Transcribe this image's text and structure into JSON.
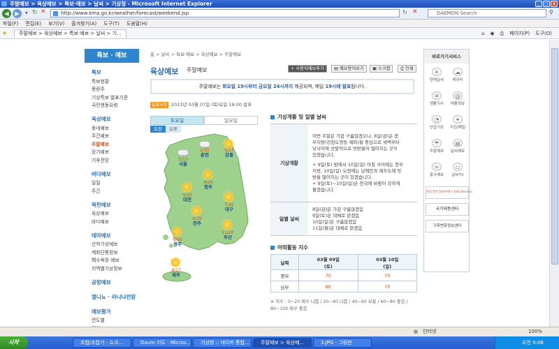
{
  "window": {
    "title": "주말예보 > 육상예보 > 특보·예보 > 날씨 > 기상청 - Microsoft Internet Explorer",
    "min": "_",
    "max": "□",
    "close": "x"
  },
  "browser": {
    "url": "http://www.kma.go.kr/weather/forecast/weekend.jsp",
    "search_placeholder": "DAEMON Search",
    "menu": [
      "파일(F)",
      "편집(E)",
      "보기(V)",
      "즐겨찾기(A)",
      "도구(T)",
      "도움말(H)"
    ],
    "tab": "주말예보 > 육상예보 > 특보·예보 > 날씨 > 기...",
    "tools": [
      "페이지(P)",
      "도구(O)"
    ],
    "status": "인터넷",
    "zoom": "100%"
  },
  "taskbar": {
    "start": "시작",
    "items": [
      "조합/조합기 - 쇼크...",
      "Daum 지도 - Micros...",
      "기상청 :: 네이버 통합...",
      "주말예보 > 육상예...",
      "3.JPG - 그림판"
    ],
    "time": "오전 9:06"
  },
  "sidebar": {
    "header": "특보 · 예보",
    "sections": [
      {
        "title": "특보",
        "items": [
          "특보현황",
          "풍랑주",
          "기상특보 발표기준",
          "국민행동요령"
        ]
      },
      {
        "title": "육상예보",
        "items": [
          "동네예보",
          "주간예보",
          "주말예보",
          "장기예보",
          "기후전망"
        ]
      },
      {
        "title": "바다예보",
        "items": [
          "일일",
          "주간"
        ]
      },
      {
        "title": "북한예보",
        "items": [
          "육상예보",
          "바다예보"
        ]
      },
      {
        "title": "테마예보",
        "items": [
          "산악기상예보",
          "계화단풍정보",
          "해수욕장 예보",
          "지역별기상정보"
        ]
      },
      {
        "title": "공항예보",
        "items": []
      },
      {
        "title": "엘니뇨 · 라니냐전망",
        "items": []
      },
      {
        "title": "예보평가",
        "items": [
          "연도별",
          "월별"
        ]
      }
    ],
    "active": "주말예보"
  },
  "breadcrumb": "홈 > 날씨 > 특보·예보 > 육상예보 > 주말예보",
  "page": {
    "title": "육상예보",
    "subtitle": "주말예보"
  },
  "toolbar": {
    "btn1": "사용자예보추가",
    "btn2": "예보용어보기",
    "btn3": "스크랩",
    "btn4": "인쇄"
  },
  "notice": {
    "pre": "주말예보는 ",
    "b1": "화요일 19시부터 금요일 24시까지",
    "mid": " 제공되며, 매일 ",
    "b2": "19시에 발표",
    "post": "됩니다."
  },
  "issued": {
    "badge": "발표시각",
    "text": "2013년 03월 07일 (목)요일 19:00 발표"
  },
  "days": {
    "sat": "토요일",
    "sun": "일요일"
  },
  "ampm": {
    "am": "오전",
    "pm": "오후"
  },
  "cities": [
    {
      "name": "서울",
      "temp": "5/13"
    },
    {
      "name": "춘천",
      "temp": "2/15"
    },
    {
      "name": "강릉",
      "temp": "5/17"
    },
    {
      "name": "청주",
      "temp": "4/20"
    },
    {
      "name": "대전",
      "temp": "4/20"
    },
    {
      "name": "대구",
      "temp": "7/20"
    },
    {
      "name": "전주",
      "temp": "4/19"
    },
    {
      "name": "광주",
      "temp": "6/20"
    },
    {
      "name": "부산",
      "temp": "11/20"
    },
    {
      "name": "제주",
      "temp": "8/17"
    }
  ],
  "outlook": {
    "header": "기상개황 및 일별 날씨",
    "row1_label": "기상개황",
    "row1_lines": [
      "이번 주말은 가끔 구름많겠으나, 8일(금)은 충",
      "부지방(강원도영동 제외)을 중심으로 새벽부터",
      "낮사이에 산발적으로 빗방울이 떨어지는 곳이",
      "있겠습니다.",
      "",
      "+ 9일(토) 밤에서 10일(일) 아침 사이에는 충부",
      "지방, 10일(일) 오전에는 남해안과 제주도에 빗",
      "방울 떨어지는 곳이 있겠습니다.",
      "+ 9일(토)~10일(일)은 전국에 바람이 강하게",
      "불겠습니다."
    ],
    "row2_label": "일별 날씨",
    "row2_lines": [
      "8일(금)은 가끔 구름많겠음",
      "9일(토)은 대체로 맑겠음",
      "10일(일)은 구름많겠음",
      "11일(월)은 대체로 맑겠음"
    ]
  },
  "activity": {
    "header": "야외활동 지수",
    "col0": "날짜",
    "col1a": "03월 09일",
    "col1b": "(토)",
    "col2a": "03월 10일",
    "col2b": "(일)",
    "rows": [
      {
        "label": "중부",
        "d1": "70",
        "d2": "70"
      },
      {
        "label": "남부",
        "d1": "80",
        "d2": "70"
      }
    ],
    "note1": "※ 지수 : 0~20 매우 나쁨 / 20~40 나쁨 / 40~60 보통 / 60~80 좋음 /",
    "note2": "80~100 매우 좋음"
  },
  "rpanel": {
    "header": "바로가기서비스",
    "icons": [
      [
        "현재날씨",
        "☀"
      ],
      [
        "레이더",
        "☁"
      ],
      [
        "생활지수",
        "≋"
      ],
      [
        "태풍정보",
        "@"
      ],
      [
        "산업기상",
        "◔"
      ],
      [
        "지진/해일",
        "✦"
      ],
      [
        "주말예보",
        "☂"
      ],
      [
        "날씨예보",
        "▤"
      ],
      [
        "홍수예보",
        "≈"
      ],
      [
        "날씨TV",
        "▭"
      ]
    ],
    "ban1": "지도기반 날씨서비스 GIS Service",
    "ban2": "국가태풍센터",
    "ban3": "기후변화정보센터"
  }
}
